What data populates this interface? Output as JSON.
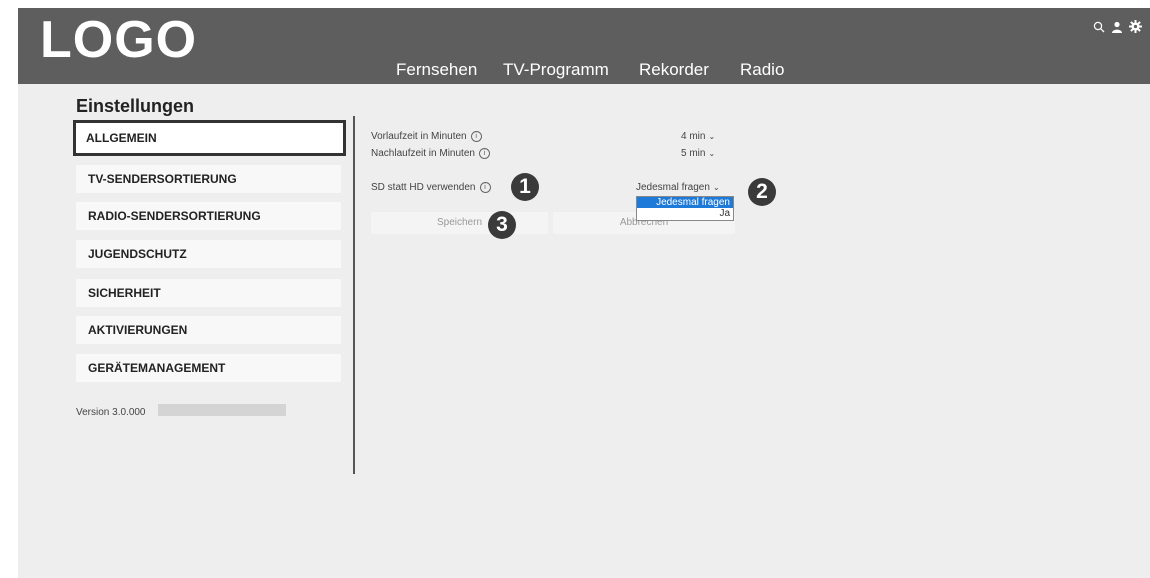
{
  "header": {
    "logo": "LOGO",
    "nav": [
      "Fernsehen",
      "TV-Programm",
      "Rekorder",
      "Radio"
    ],
    "icons": [
      "search-icon",
      "user-icon",
      "gear-icon"
    ]
  },
  "page_title": "Einstellungen",
  "sidebar": {
    "items": [
      {
        "label": "ALLGEMEIN"
      },
      {
        "label": "TV-SENDERSORTIERUNG"
      },
      {
        "label": "RADIO-SENDERSORTIERUNG"
      },
      {
        "label": "JUGENDSCHUTZ"
      },
      {
        "label": "SICHERHEIT"
      },
      {
        "label": "AKTIVIERUNGEN"
      },
      {
        "label": "GERÄTEMANAGEMENT"
      }
    ],
    "version": "Version 3.0.000"
  },
  "settings": {
    "vorlauf": {
      "label": "Vorlaufzeit in Minuten",
      "value": "4 min"
    },
    "nachlauf": {
      "label": "Nachlaufzeit in Minuten",
      "value": "5 min"
    },
    "sd_hd": {
      "label": "SD statt HD verwenden",
      "value": "Jedesmal fragen",
      "options": [
        "Jedesmal fragen",
        "Ja"
      ]
    },
    "info_glyph": "i"
  },
  "buttons": {
    "save": "Speichern",
    "cancel": "Abbrechen"
  },
  "badges": [
    "1",
    "2",
    "3"
  ],
  "colors": {
    "header_bg": "#5e5e5e",
    "page_bg": "#eeeeee",
    "selected_option": "#1e7ad8",
    "badge": "#3a3a3a"
  }
}
